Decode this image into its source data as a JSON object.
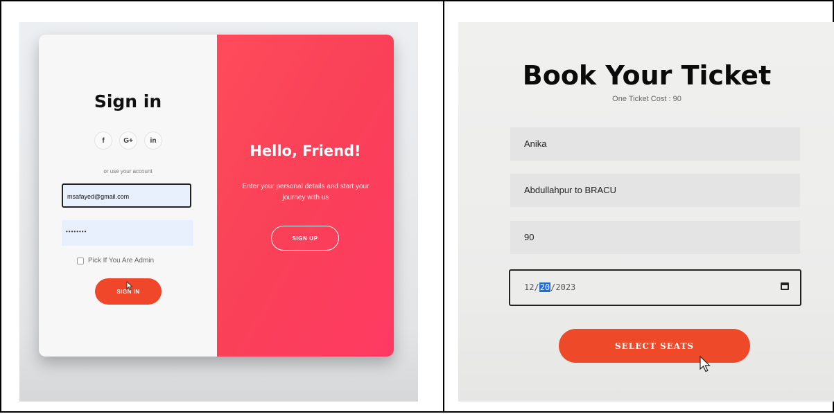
{
  "signin_screen": {
    "title": "Sign in",
    "social_icons": [
      {
        "icon": "facebook-icon",
        "glyph": "f"
      },
      {
        "icon": "google-plus-icon",
        "glyph": "G+"
      },
      {
        "icon": "linkedin-icon",
        "glyph": "in"
      }
    ],
    "or_text": "or use your account",
    "email_value": "msafayed@gmail.com",
    "password_masked": "••••••••",
    "admin_checkbox_label": "Pick If You Are Admin",
    "signin_button": "SIGN IN",
    "hello_title": "Hello, Friend!",
    "hello_text": "Enter your personal details and start your journey with us",
    "signup_button": "SIGN UP"
  },
  "booking_screen": {
    "title": "Book Your Ticket",
    "subtitle": "One Ticket Cost : 90",
    "name_value": "Anika",
    "route_value": "Abdullahpur to BRACU",
    "cost_value": "90",
    "date_month": "12",
    "date_day": "20",
    "date_year": "2023",
    "select_seats_button": "SELECT SEATS"
  },
  "colors": {
    "accent_red": "#f0462a",
    "panel_gradient": "#ff4b5c",
    "date_selection": "#1e6ce0"
  }
}
